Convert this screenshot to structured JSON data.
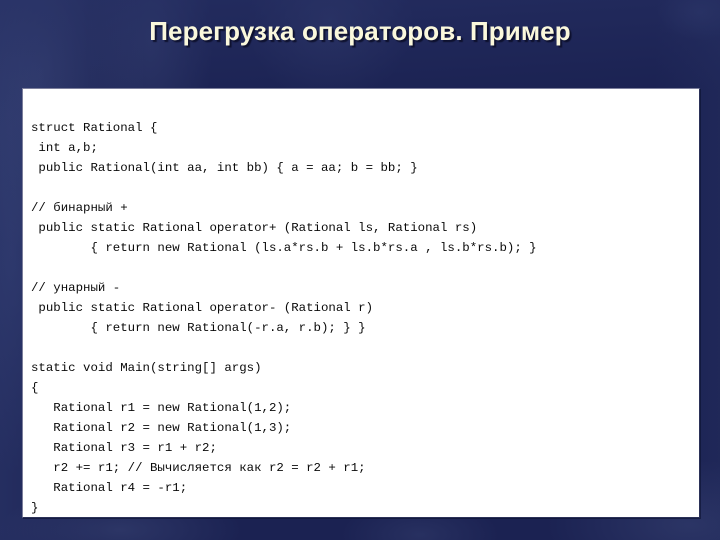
{
  "slide": {
    "title": "Перегрузка операторов. Пример",
    "background_color": "#1b2252",
    "title_color": "#faf8dc",
    "panel_background_color": "#ffffff",
    "code_text_color": "#0a0a0a"
  },
  "code": {
    "language": "C#",
    "lines": [
      "struct Rational {",
      " int a,b;",
      " public Rational(int aa, int bb) { a = aa; b = bb; }",
      "",
      "// бинарный +",
      " public static Rational operator+ (Rational ls, Rational rs)",
      "        { return new Rational (ls.a*rs.b + ls.b*rs.a , ls.b*rs.b); }",
      "",
      "// унарный -",
      " public static Rational operator- (Rational r)",
      "        { return new Rational(-r.a, r.b); } }",
      "",
      "static void Main(string[] args)",
      "{",
      "   Rational r1 = new Rational(1,2);",
      "   Rational r2 = new Rational(1,3);",
      "   Rational r3 = r1 + r2;",
      "   r2 += r1; // Вычисляется как r2 = r2 + r1;",
      "   Rational r4 = -r1;",
      "}"
    ]
  }
}
